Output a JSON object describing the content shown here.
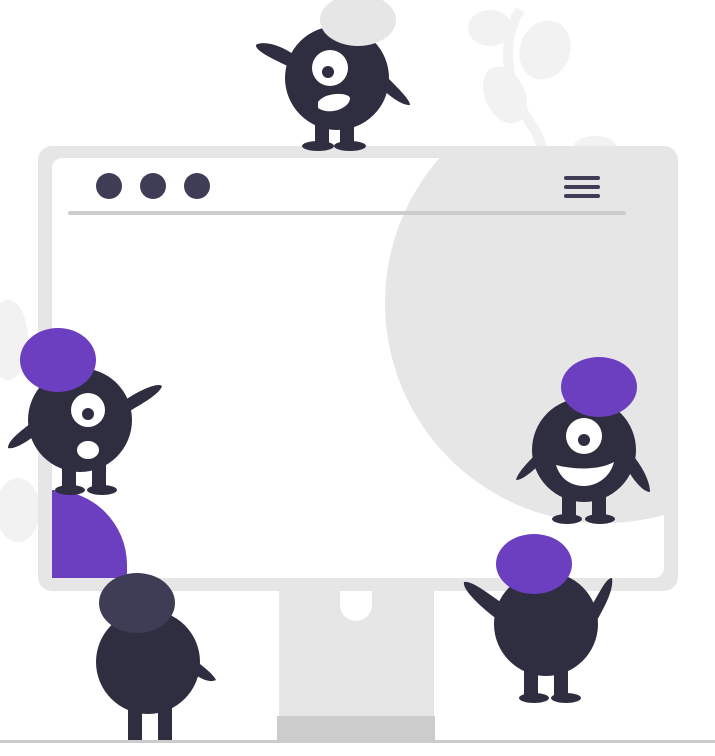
{
  "colors": {
    "background": "#ffffff",
    "monitor_frame": "#e6e6e6",
    "screen": "#ffffff",
    "decor_circle": "#e6e6e6",
    "divider": "#cccccc",
    "dots": "#3f3d56",
    "menu_icon": "#3f3d56",
    "creature_body": "#2f2e41",
    "creature_hat_purple": "#6c3fc0",
    "creature_hat_dark": "#3f3d56",
    "creature_hat_grey": "#e6e6e6",
    "eye_white": "#ffffff",
    "foliage": "#f2f2f2",
    "stand_base": "#cccccc",
    "floor": "#cccccc"
  },
  "window": {
    "dots": [
      "dot",
      "dot",
      "dot"
    ],
    "menu_icon": "hamburger-menu-icon"
  },
  "creatures": [
    {
      "name": "creature-top",
      "hat": "grey",
      "expression": "mouth-open"
    },
    {
      "name": "creature-left",
      "hat": "purple",
      "expression": "mouth-open"
    },
    {
      "name": "creature-right",
      "hat": "purple",
      "expression": "smile"
    },
    {
      "name": "creature-bottom-left",
      "hat": "dark",
      "expression": "back-view"
    },
    {
      "name": "creature-bottom-right",
      "hat": "purple",
      "expression": "back-view"
    }
  ]
}
